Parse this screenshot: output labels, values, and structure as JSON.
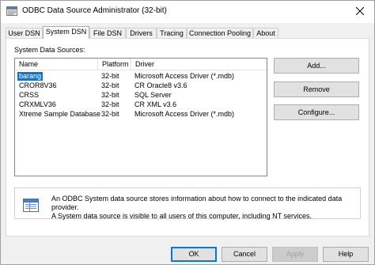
{
  "window": {
    "title": "ODBC Data Source Administrator (32-bit)",
    "icons": {
      "app": "odbc-app-icon",
      "close": "close-icon"
    }
  },
  "tabs": [
    {
      "label": "User DSN",
      "active": false
    },
    {
      "label": "System DSN",
      "active": true
    },
    {
      "label": "File DSN",
      "active": false
    },
    {
      "label": "Drivers",
      "active": false
    },
    {
      "label": "Tracing",
      "active": false
    },
    {
      "label": "Connection Pooling",
      "active": false
    },
    {
      "label": "About",
      "active": false
    }
  ],
  "system_dsn": {
    "section_label": "System Data Sources:",
    "columns": {
      "name": "Name",
      "platform": "Platform",
      "driver": "Driver"
    },
    "rows": [
      {
        "name": "barang",
        "platform": "32-bit",
        "driver": "Microsoft Access Driver (*.mdb)",
        "selected": true
      },
      {
        "name": "CROR8V36",
        "platform": "32-bit",
        "driver": "CR Oracle8 v3.6",
        "selected": false
      },
      {
        "name": "CRSS",
        "platform": "32-bit",
        "driver": "SQL Server",
        "selected": false
      },
      {
        "name": "CRXMLV36",
        "platform": "32-bit",
        "driver": "CR XML v3.6",
        "selected": false
      },
      {
        "name": "Xtreme Sample Database",
        "platform": "32-bit",
        "driver": "Microsoft Access Driver (*.mdb)",
        "selected": false
      }
    ],
    "buttons": {
      "add": "Add...",
      "remove": "Remove",
      "configure": "Configure..."
    },
    "info": {
      "icon": "data-source-info-icon",
      "line1": "An ODBC System data source stores information about how to connect to the indicated data provider.",
      "line2": "A System data source is visible to all users of this computer, including NT services."
    }
  },
  "footer": {
    "ok": "OK",
    "cancel": "Cancel",
    "apply": "Apply",
    "help": "Help"
  },
  "colors": {
    "selection": "#0078d7",
    "window_bg": "#f0f0f0",
    "button_bg": "#e1e1e1"
  }
}
